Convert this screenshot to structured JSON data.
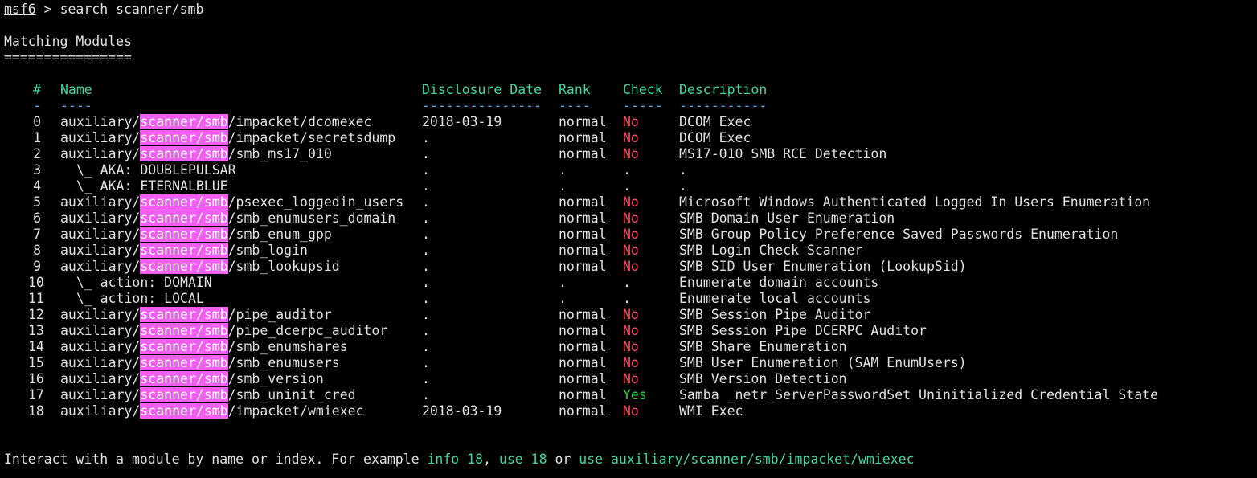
{
  "terminal": {
    "prompt": "msf6",
    "prompt_sep": " > ",
    "command": "search scanner/smb",
    "section_title": "Matching Modules",
    "section_underline": "================",
    "headers": {
      "num": "#",
      "name": "Name",
      "date": "Disclosure Date",
      "rank": "Rank",
      "check": "Check",
      "description": "Description"
    },
    "underlines": {
      "num": "-",
      "name": "----",
      "date": "---------------",
      "rank": "----",
      "check": "-----",
      "description": "-----------"
    },
    "highlight_term": "scanner/smb",
    "rows": [
      {
        "num": "0",
        "prefix": "auxiliary/",
        "hl": "scanner/smb",
        "suffix": "/impacket/dcomexec",
        "date": "2018-03-19",
        "rank": "normal",
        "check": "No",
        "desc": "DCOM Exec"
      },
      {
        "num": "1",
        "prefix": "auxiliary/",
        "hl": "scanner/smb",
        "suffix": "/impacket/secretsdump",
        "date": ".",
        "rank": "normal",
        "check": "No",
        "desc": "DCOM Exec"
      },
      {
        "num": "2",
        "prefix": "auxiliary/",
        "hl": "scanner/smb",
        "suffix": "/smb_ms17_010",
        "date": ".",
        "rank": "normal",
        "check": "No",
        "desc": "MS17-010 SMB RCE Detection"
      },
      {
        "num": "3",
        "prefix": "  \\_ AKA: DOUBLEPULSAR",
        "hl": "",
        "suffix": "",
        "date": ".",
        "rank": ".",
        "check": ".",
        "desc": "."
      },
      {
        "num": "4",
        "prefix": "  \\_ AKA: ETERNALBLUE",
        "hl": "",
        "suffix": "",
        "date": ".",
        "rank": ".",
        "check": ".",
        "desc": "."
      },
      {
        "num": "5",
        "prefix": "auxiliary/",
        "hl": "scanner/smb",
        "suffix": "/psexec_loggedin_users",
        "date": ".",
        "rank": "normal",
        "check": "No",
        "desc": "Microsoft Windows Authenticated Logged In Users Enumeration"
      },
      {
        "num": "6",
        "prefix": "auxiliary/",
        "hl": "scanner/smb",
        "suffix": "/smb_enumusers_domain",
        "date": ".",
        "rank": "normal",
        "check": "No",
        "desc": "SMB Domain User Enumeration"
      },
      {
        "num": "7",
        "prefix": "auxiliary/",
        "hl": "scanner/smb",
        "suffix": "/smb_enum_gpp",
        "date": ".",
        "rank": "normal",
        "check": "No",
        "desc": "SMB Group Policy Preference Saved Passwords Enumeration"
      },
      {
        "num": "8",
        "prefix": "auxiliary/",
        "hl": "scanner/smb",
        "suffix": "/smb_login",
        "date": ".",
        "rank": "normal",
        "check": "No",
        "desc": "SMB Login Check Scanner"
      },
      {
        "num": "9",
        "prefix": "auxiliary/",
        "hl": "scanner/smb",
        "suffix": "/smb_lookupsid",
        "date": ".",
        "rank": "normal",
        "check": "No",
        "desc": "SMB SID User Enumeration (LookupSid)"
      },
      {
        "num": "10",
        "prefix": "  \\_ action: DOMAIN",
        "hl": "",
        "suffix": "",
        "date": ".",
        "rank": ".",
        "check": ".",
        "desc": "Enumerate domain accounts"
      },
      {
        "num": "11",
        "prefix": "  \\_ action: LOCAL",
        "hl": "",
        "suffix": "",
        "date": ".",
        "rank": ".",
        "check": ".",
        "desc": "Enumerate local accounts"
      },
      {
        "num": "12",
        "prefix": "auxiliary/",
        "hl": "scanner/smb",
        "suffix": "/pipe_auditor",
        "date": ".",
        "rank": "normal",
        "check": "No",
        "desc": "SMB Session Pipe Auditor"
      },
      {
        "num": "13",
        "prefix": "auxiliary/",
        "hl": "scanner/smb",
        "suffix": "/pipe_dcerpc_auditor",
        "date": ".",
        "rank": "normal",
        "check": "No",
        "desc": "SMB Session Pipe DCERPC Auditor"
      },
      {
        "num": "14",
        "prefix": "auxiliary/",
        "hl": "scanner/smb",
        "suffix": "/smb_enumshares",
        "date": ".",
        "rank": "normal",
        "check": "No",
        "desc": "SMB Share Enumeration"
      },
      {
        "num": "15",
        "prefix": "auxiliary/",
        "hl": "scanner/smb",
        "suffix": "/smb_enumusers",
        "date": ".",
        "rank": "normal",
        "check": "No",
        "desc": "SMB User Enumeration (SAM EnumUsers)"
      },
      {
        "num": "16",
        "prefix": "auxiliary/",
        "hl": "scanner/smb",
        "suffix": "/smb_version",
        "date": ".",
        "rank": "normal",
        "check": "No",
        "desc": "SMB Version Detection"
      },
      {
        "num": "17",
        "prefix": "auxiliary/",
        "hl": "scanner/smb",
        "suffix": "/smb_uninit_cred",
        "date": ".",
        "rank": "normal",
        "check": "Yes",
        "desc": "Samba _netr_ServerPasswordSet Uninitialized Credential State"
      },
      {
        "num": "18",
        "prefix": "auxiliary/",
        "hl": "scanner/smb",
        "suffix": "/impacket/wmiexec",
        "date": "2018-03-19",
        "rank": "normal",
        "check": "No",
        "desc": "WMI Exec"
      }
    ],
    "footer": {
      "text1": "Interact with a module by name or index. For example ",
      "link1": "info 18",
      "text2": ", ",
      "link2": "use 18",
      "text3": " or ",
      "link3": "use auxiliary/scanner/smb/impacket/wmiexec"
    },
    "colors": {
      "background": "#000000",
      "text": "#e0e0e0",
      "header": "#3fd6a0",
      "separator": "#5aa8e6",
      "no": "#ff4d5e",
      "yes": "#2bd43b",
      "highlight": "#f25df2"
    }
  }
}
